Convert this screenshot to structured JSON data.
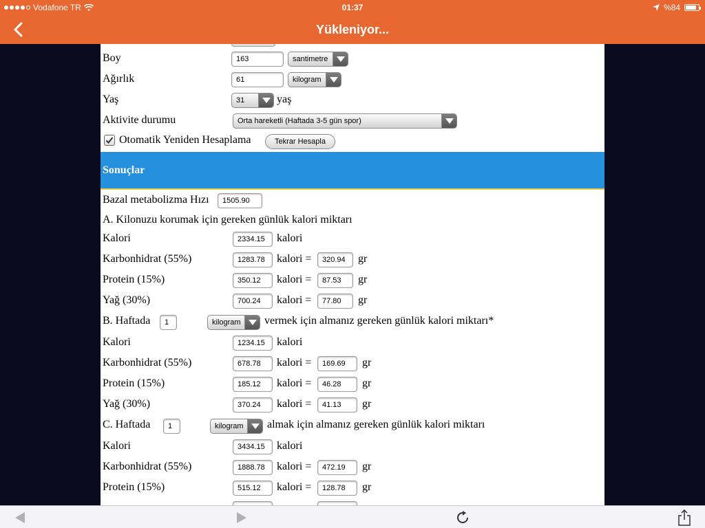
{
  "status": {
    "carrier": "Vodafone TR",
    "time": "01:37",
    "battery": "%84",
    "battery_level": 0.84
  },
  "nav": {
    "title": "Yükleniyor..."
  },
  "form": {
    "height_label": "Boy",
    "height_value": "163",
    "height_unit": "santimetre",
    "weight_label": "Ağırlık",
    "weight_value": "61",
    "weight_unit": "kilogram",
    "age_label": "Yaş",
    "age_value": "31",
    "age_suffix": "yaş",
    "activity_label": "Aktivite durumu",
    "activity_value": "Orta hareketli (Haftada 3-5 gün spor)",
    "auto_label": "Otomatik Yeniden Hesaplama",
    "auto_checked": true,
    "recalc_button": "Tekrar Hesapla"
  },
  "results": {
    "heading": "Sonuçlar",
    "bmr_label": "Bazal metabolizma Hızı",
    "bmr_value": "1505.90",
    "kalori_word": "kalori",
    "kalori_eq": "kalori =",
    "gr": "gr",
    "calorie_label": "Kalori",
    "carb_label": "Karbonhidrat (55%)",
    "protein_label": "Protein (15%)",
    "fat_label": "Yağ (30%)",
    "section_a": {
      "title": "A. Kilonuzu korumak için gereken günlük kalori miktarı",
      "calories": "2334.15",
      "carb_kcal": "1283.78",
      "carb_gr": "320.94",
      "protein_kcal": "350.12",
      "protein_gr": "87.53",
      "fat_kcal": "700.24",
      "fat_gr": "77.80"
    },
    "section_b": {
      "prefix": "B. Haftada",
      "amount": "1",
      "unit": "kilogram",
      "suffix": "vermek için almanız gereken günlük kalori miktarı*",
      "calories": "1234.15",
      "carb_kcal": "678.78",
      "carb_gr": "169.69",
      "protein_kcal": "185.12",
      "protein_gr": "46.28",
      "fat_kcal": "370.24",
      "fat_gr": "41.13"
    },
    "section_c": {
      "prefix": "C. Haftada",
      "amount": "1",
      "unit": "kilogram",
      "suffix": "almak için almanız gereken günlük kalori miktarı",
      "calories": "3434.15",
      "carb_kcal": "1888.78",
      "carb_gr": "472.19",
      "protein_kcal": "515.12",
      "protein_gr": "128.78"
    }
  },
  "icons": {
    "back": "chevron-left-icon",
    "signal": "signal-dots-icon",
    "wifi": "wifi-icon",
    "location": "location-arrow-icon",
    "nav_back": "triangle-left-icon",
    "nav_forward": "triangle-right-icon",
    "reload": "reload-icon",
    "share": "share-icon"
  },
  "colors": {
    "accent": "#e8662f",
    "results_header": "#2591de",
    "side_background": "#0a0a1e"
  }
}
